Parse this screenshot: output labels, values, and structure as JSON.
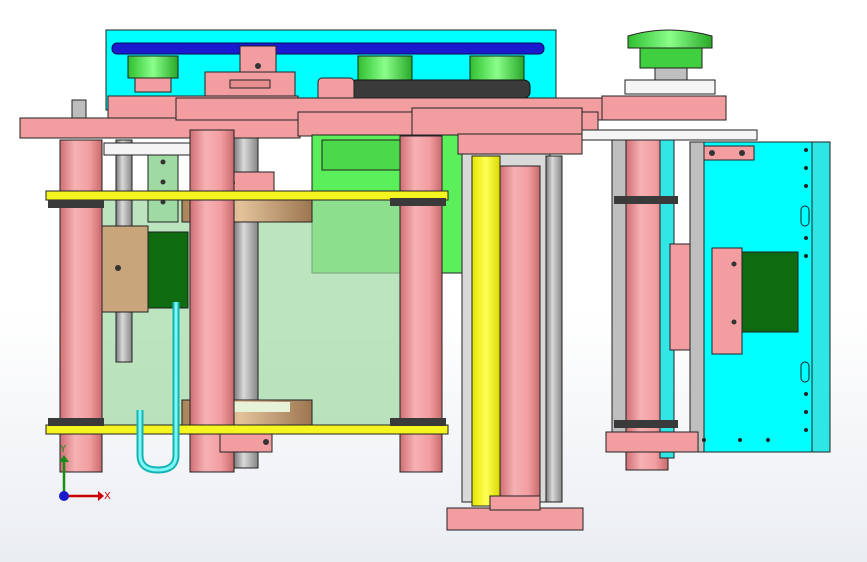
{
  "viewport": {
    "background": "#ffffff",
    "background_bottom": "#eaedf2"
  },
  "triad": {
    "x_label": "X",
    "y_label": "Y",
    "x_color": "#cc0000",
    "y_color": "#1a8a1a",
    "z_color": "#1a1acc"
  },
  "palette": {
    "cyan_plate": "#00ffff",
    "pink_part": "#f29ea1",
    "green_part": "#5cef5c",
    "dark_green_part": "#0f6b0f",
    "yellow_part": "#f5f51f",
    "blue_belt": "#1a1ad1",
    "gray_rod": "#a8a8a8",
    "tan_part": "#c9a57c",
    "light_green_panel": "#9fd9a3",
    "dark_band": "#3a3a3a",
    "outline": "#222222"
  }
}
